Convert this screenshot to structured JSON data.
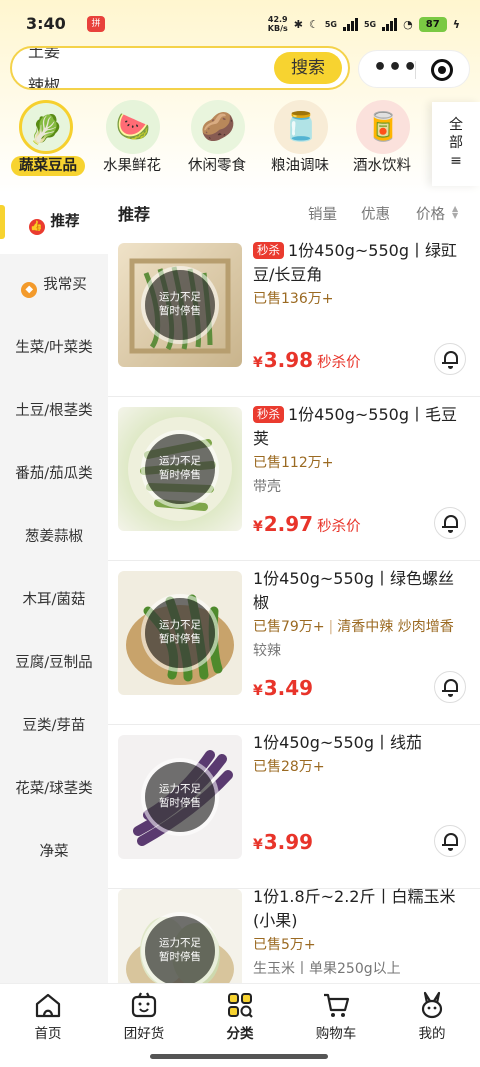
{
  "status_bar": {
    "time": "3:40",
    "app_badge": "拼",
    "net_speed_value": "42.9",
    "net_speed_unit": "KB/s",
    "signal_a": "5G",
    "signal_b": "5G",
    "battery": "87"
  },
  "search": {
    "line1": "土姜",
    "line2": "辣椒",
    "button": "搜索"
  },
  "capsule": {
    "more_icon": "more-dots-icon",
    "close_icon": "target-close-icon"
  },
  "categories": [
    {
      "label": "蔬菜豆品",
      "icon": "vegetable-icon",
      "active": true
    },
    {
      "label": "水果鲜花",
      "icon": "watermelon-icon"
    },
    {
      "label": "休闲零食",
      "icon": "snack-icon"
    },
    {
      "label": "粮油调味",
      "icon": "oil-icon"
    },
    {
      "label": "酒水饮料",
      "icon": "drink-can-icon"
    }
  ],
  "all_categories": {
    "line1": "全",
    "line2": "部"
  },
  "sidebar": [
    {
      "label": "推荐",
      "active": true
    },
    {
      "label": "我常买"
    },
    {
      "label": "生菜/叶菜类"
    },
    {
      "label": "土豆/根茎类"
    },
    {
      "label": "番茄/茄瓜类"
    },
    {
      "label": "葱姜蒜椒"
    },
    {
      "label": "木耳/菌菇"
    },
    {
      "label": "豆腐/豆制品"
    },
    {
      "label": "豆类/芽苗"
    },
    {
      "label": "花菜/球茎类"
    },
    {
      "label": "净菜"
    }
  ],
  "sort": {
    "title": "推荐",
    "sales": "销量",
    "discount": "优惠",
    "price": "价格"
  },
  "soldout": {
    "line1": "运力不足",
    "line2": "暂时停售"
  },
  "products": [
    {
      "badge": "秒杀",
      "title": "1份450g~550g丨绿豇豆/长豆角",
      "sold": "已售136万+",
      "tags": [],
      "note": "",
      "yen": "¥",
      "price": "3.98",
      "flash": "秒杀价"
    },
    {
      "badge": "秒杀",
      "title": "1份450g~550g丨毛豆荚",
      "sold": "已售112万+",
      "tags": [],
      "note": "带壳",
      "yen": "¥",
      "price": "2.97",
      "flash": "秒杀价"
    },
    {
      "badge": "",
      "title": "1份450g~550g丨绿色螺丝椒",
      "sold": "已售79万+",
      "tags": [
        "清香中辣",
        "炒肉增香"
      ],
      "note": "较辣",
      "yen": "¥",
      "price": "3.49",
      "flash": ""
    },
    {
      "badge": "",
      "title": "1份450g~550g丨线茄",
      "sold": "已售28万+",
      "tags": [],
      "note": "",
      "yen": "¥",
      "price": "3.99",
      "flash": ""
    },
    {
      "badge": "",
      "title": "1份1.8斤~2.2斤丨白糯玉米(小果)",
      "sold": "已售5万+",
      "tags": [],
      "note": "生玉米丨单果250g以上",
      "yen": "",
      "price": "",
      "flash": ""
    }
  ],
  "tabs": [
    {
      "label": "首页",
      "icon": "home-icon"
    },
    {
      "label": "团好货",
      "icon": "group-buy-icon"
    },
    {
      "label": "分类",
      "icon": "category-grid-icon",
      "active": true
    },
    {
      "label": "购物车",
      "icon": "cart-icon"
    },
    {
      "label": "我的",
      "icon": "rabbit-profile-icon"
    }
  ],
  "colors": {
    "accent": "#f7d330",
    "price_red": "#e8342a",
    "sold_brown": "#9b6a22"
  }
}
